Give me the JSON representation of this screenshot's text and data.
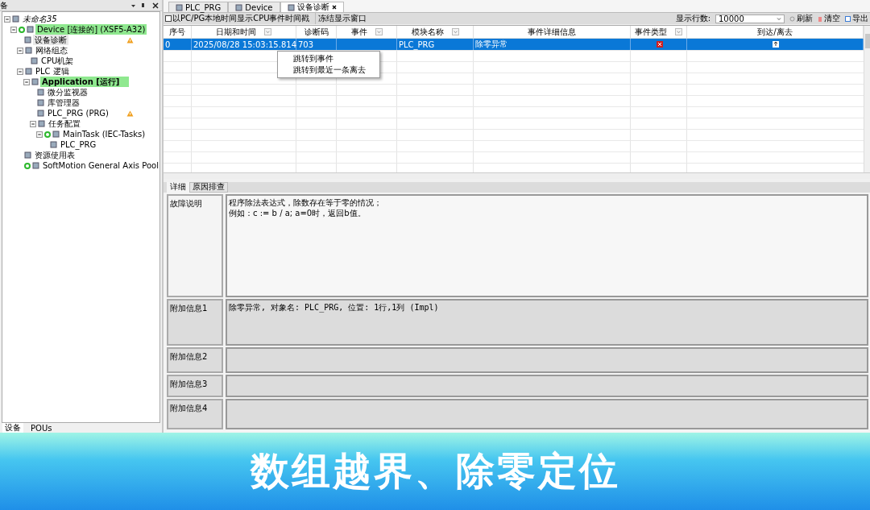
{
  "devices_panel": {
    "title": "备",
    "tree": [
      {
        "label": "未命名35",
        "italic": true,
        "expanded": true,
        "children": [
          {
            "label": "Device [连接的] (XSF5-A32)",
            "running": true,
            "highlighted": true,
            "expanded": true,
            "children": [
              {
                "label": "设备诊断",
                "selected": true,
                "warning": true
              },
              {
                "label": "网络组态",
                "expanded": true,
                "children": [
                  {
                    "label": "CPU机架"
                  }
                ]
              },
              {
                "label": "PLC 逻辑",
                "expanded": true,
                "children": [
                  {
                    "label": "Application [运行]",
                    "bold": true,
                    "highlighted": true,
                    "expanded": true,
                    "children": [
                      {
                        "label": "微分监视器"
                      },
                      {
                        "label": "库管理器"
                      },
                      {
                        "label": "PLC_PRG (PRG)",
                        "warning": true
                      },
                      {
                        "label": "任务配置",
                        "expanded": true,
                        "children": [
                          {
                            "label": "MainTask (IEC-Tasks)",
                            "running": true,
                            "expanded": true,
                            "children": [
                              {
                                "label": "PLC_PRG"
                              }
                            ]
                          }
                        ]
                      }
                    ]
                  }
                ]
              },
              {
                "label": "资源使用表"
              },
              {
                "label": "SoftMotion General Axis Pool",
                "running": true
              }
            ]
          }
        ]
      }
    ],
    "bottom_tabs": [
      {
        "label": "设备",
        "selected": true
      },
      {
        "label": "POUs",
        "selected": false
      }
    ]
  },
  "editor_tabs": [
    {
      "label": "PLC_PRG",
      "selected": false
    },
    {
      "label": "Device",
      "selected": false
    },
    {
      "label": "设备诊断",
      "selected": true,
      "closable": true
    }
  ],
  "toolbar": {
    "timestamp_checkbox": {
      "label": "以PC/PG本地时间显示CPU事件时间戳",
      "checked": false
    },
    "freeze_button": "冻结显示窗口",
    "rows_label": "显示行数:",
    "rows_value": "10000",
    "refresh": "刷新",
    "clear": "清空",
    "export": "导出"
  },
  "table": {
    "columns": [
      {
        "label": "序号",
        "filter": false
      },
      {
        "label": "日期和时间",
        "filter": true
      },
      {
        "label": "诊断码",
        "filter": false
      },
      {
        "label": "事件",
        "filter": true
      },
      {
        "label": "模块名称",
        "filter": true
      },
      {
        "label": "事件详细信息",
        "filter": false
      },
      {
        "label": "事件类型",
        "filter": true
      },
      {
        "label": "到达/离去",
        "filter": false
      }
    ],
    "rows": [
      {
        "selected": true,
        "cells": [
          "0",
          "2025/08/28 15:03:15.814",
          "703",
          "",
          "PLC_PRG",
          "除零异常"
        ]
      }
    ]
  },
  "context_menu": [
    "跳转到事件",
    "跳转到最近一条离去"
  ],
  "detail_tabs": [
    {
      "label": "详细",
      "selected": true
    },
    {
      "label": "原因排查",
      "selected": false
    }
  ],
  "details": [
    {
      "label": "故障说明",
      "lines": [
        "程序除法表达式，除数存在等于零的情况；",
        "例如：c := b / a; a=0时，返回b值。"
      ],
      "kind": "text"
    },
    {
      "label": "附加信息1",
      "lines": [
        "除零异常, 对象名: PLC_PRG, 位置: 1行,1列 (Impl)"
      ],
      "kind": "mono"
    },
    {
      "label": "附加信息2",
      "kind": "mono"
    },
    {
      "label": "附加信息3",
      "kind": "mono"
    },
    {
      "label": "附加信息4",
      "kind": "mono"
    }
  ],
  "banner": {
    "caption": "数组越界、除零定位"
  }
}
